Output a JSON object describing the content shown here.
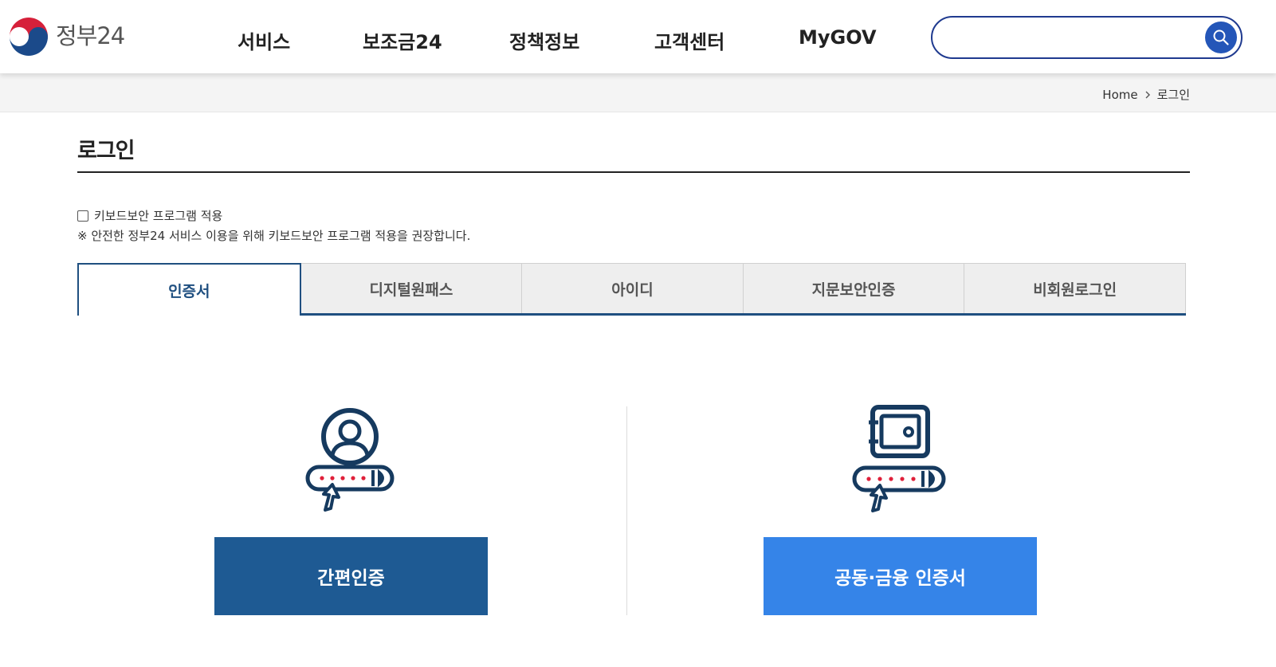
{
  "header": {
    "logo_text": "정부24",
    "nav": [
      "서비스",
      "보조금24",
      "정책정보",
      "고객센터",
      "MyGOV"
    ],
    "search": {
      "value": "",
      "placeholder": ""
    }
  },
  "breadcrumb": {
    "home": "Home",
    "current": "로그인"
  },
  "page": {
    "title": "로그인"
  },
  "keyboard_security": {
    "checkbox_label": "키보드보안 프로그램 적용",
    "checked": false,
    "note": "※ 안전한 정부24 서비스 이용을 위해 키보드보안 프로그램 적용을 권장합니다."
  },
  "tabs": [
    {
      "label": "인증서",
      "active": true
    },
    {
      "label": "디지털원패스",
      "active": false
    },
    {
      "label": "아이디",
      "active": false
    },
    {
      "label": "지문보안인증",
      "active": false
    },
    {
      "label": "비회원로그인",
      "active": false
    }
  ],
  "login_options": {
    "simple_auth_label": "간편인증",
    "cert_label": "공동·금융 인증서"
  },
  "colors": {
    "navy": "#1f4f80",
    "simple_button": "#1e5a93",
    "cert_button": "#3584e8",
    "search_border": "#1f3a8f",
    "icon_navy": "#163a5f",
    "dot_red": "#e0203a"
  },
  "icons": [
    "taegeuk-emblem-icon",
    "search-icon",
    "chevron-right-icon",
    "user-login-icon",
    "safe-cert-icon",
    "pointer-cursor-icon"
  ]
}
